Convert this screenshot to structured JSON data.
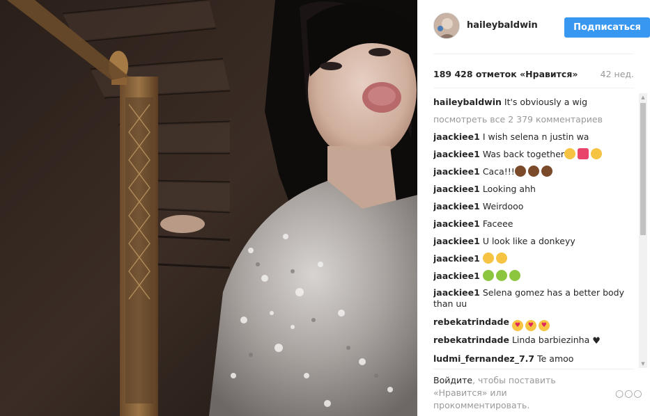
{
  "post": {
    "username": "haileybaldwin",
    "follow_label": "Подписаться",
    "likes_text": "189 428 отметок «Нравится»",
    "time_ago": "42 нед.",
    "caption_text": "It's obviously a wig",
    "view_all_comments": "посмотреть все 2 379 комментариев"
  },
  "comments": [
    {
      "user": "jaackiee1",
      "text": "I wish selena n justin wa",
      "emojis": []
    },
    {
      "user": "jaackiee1",
      "text": "Was back together",
      "emojis": [
        "weary-face-emoji",
        "heart-ribbon-emoji",
        "loudly-crying-face-emoji"
      ]
    },
    {
      "user": "jaackiee1",
      "text": "Caca!!!",
      "emojis": [
        "pile-of-poo-emoji",
        "pile-of-poo-emoji",
        "pile-of-poo-emoji"
      ]
    },
    {
      "user": "jaackiee1",
      "text": "Looking ahh",
      "emojis": []
    },
    {
      "user": "jaackiee1",
      "text": "Weirdooo",
      "emojis": []
    },
    {
      "user": "jaackiee1",
      "text": "Faceee",
      "emojis": []
    },
    {
      "user": "jaackiee1",
      "text": "U look like a donkeyy",
      "emojis": []
    },
    {
      "user": "jaackiee1",
      "text": "",
      "emojis": [
        "tears-of-joy-emoji",
        "tears-of-joy-emoji"
      ]
    },
    {
      "user": "jaackiee1",
      "text": "",
      "emojis": [
        "nauseated-face-emoji",
        "nauseated-face-emoji",
        "nauseated-face-emoji"
      ]
    },
    {
      "user": "jaackiee1",
      "text": "Selena gomez has a better body than uu",
      "emojis": []
    },
    {
      "user": "rebekatrindade",
      "text": "",
      "emojis": [
        "heart-eyes-emoji",
        "heart-eyes-emoji",
        "heart-eyes-emoji"
      ]
    },
    {
      "user": "rebekatrindade",
      "text": "Linda barbiezinha",
      "emojis": [
        "black-heart-icon"
      ]
    },
    {
      "user": "ludmi_fernandez_7.7",
      "text": "Te amoo",
      "emojis": []
    }
  ],
  "footer": {
    "login_link": "Войдите",
    "prompt_text": ", чтобы поставить «Нравится» или прокомментировать.",
    "more_icon": "more-options-icon"
  },
  "colors": {
    "accent": "#3897f0",
    "muted_text": "#999999",
    "text": "#262626",
    "divider": "#efefef"
  }
}
